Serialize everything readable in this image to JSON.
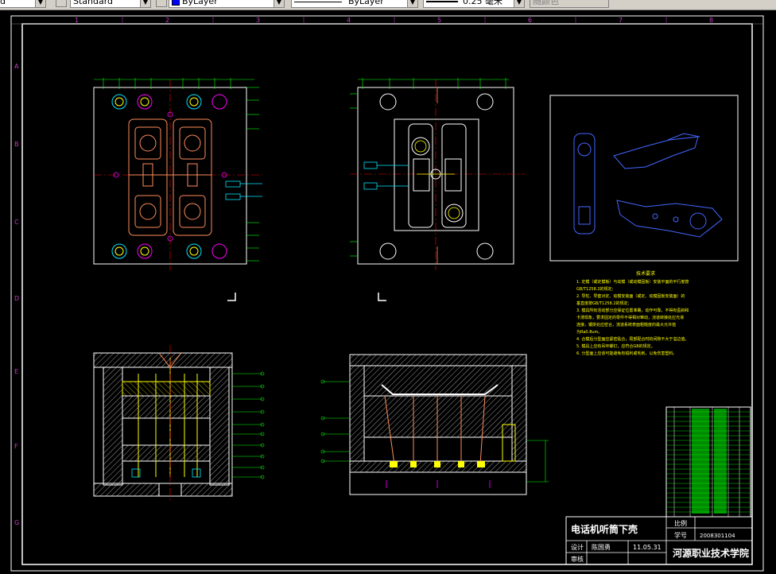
{
  "toolbar": {
    "combo1": "d",
    "combo2": "Standard",
    "layer": "ByLayer",
    "linetype": "ByLayer",
    "lineweight": "0.25 毫米",
    "plotstyle": "随颜色"
  },
  "frame": {
    "col_marks": [
      "1",
      "2",
      "3",
      "4",
      "5",
      "6",
      "7",
      "8"
    ],
    "row_marks": [
      "A",
      "B",
      "C",
      "D",
      "E",
      "F",
      "G"
    ]
  },
  "tech_requirements": {
    "heading": "技术要求",
    "lines": [
      "1. 定模（或定模板）与动模（或动模固板）安装平面的平行度按",
      "   GB/T1258.2的规定;",
      "2. 导柱、导套对定、动模安装面（或定、动模固板安装面）的",
      "   垂直度按GB/T1258.2的规定;",
      "3. 模具所有活动部分应保证位置准确，动作可靠，不得有歪斜和",
      "   卡滞现象，要求固定的零件不得相对窜动，浇道转接处应光滑",
      "   连接，镶拼处应密合，流道系统表面粗糙度的最大允许值",
      "   为Ra0.8um。",
      "4. 合模后分型面应紧密贴合，局部配合时的间隙不大于溢边值。",
      "5. 模具上应有吊环螺钉，应符合GB的规定。",
      "6. 分型面上应该可能避免有锐利或毛刺，以免伤害塑料。"
    ]
  },
  "title_block": {
    "drawing_name": "电话机听筒下壳",
    "ratio_label": "比例",
    "student_id_label": "学号",
    "student_id": "2008301104",
    "designer_label": "设计",
    "designer": "陈国勇",
    "date": "11.05.31",
    "reviewer_label": "审核",
    "school": "河源职业技术学院"
  },
  "colors": {
    "background": "#000000",
    "frame": "#ffffff",
    "plate": "#ffffff",
    "part": "#ff8c5a",
    "dimension": "#00ff00",
    "ring": "#ff00ff",
    "section": "#ffff00",
    "centerline": "#ff0000",
    "iso_view": "#4466ff",
    "cyan": "#00e5ff"
  },
  "icons": {
    "layer_swatch": "blue-color-swatch",
    "dropdown": "chevron-down-icon"
  }
}
